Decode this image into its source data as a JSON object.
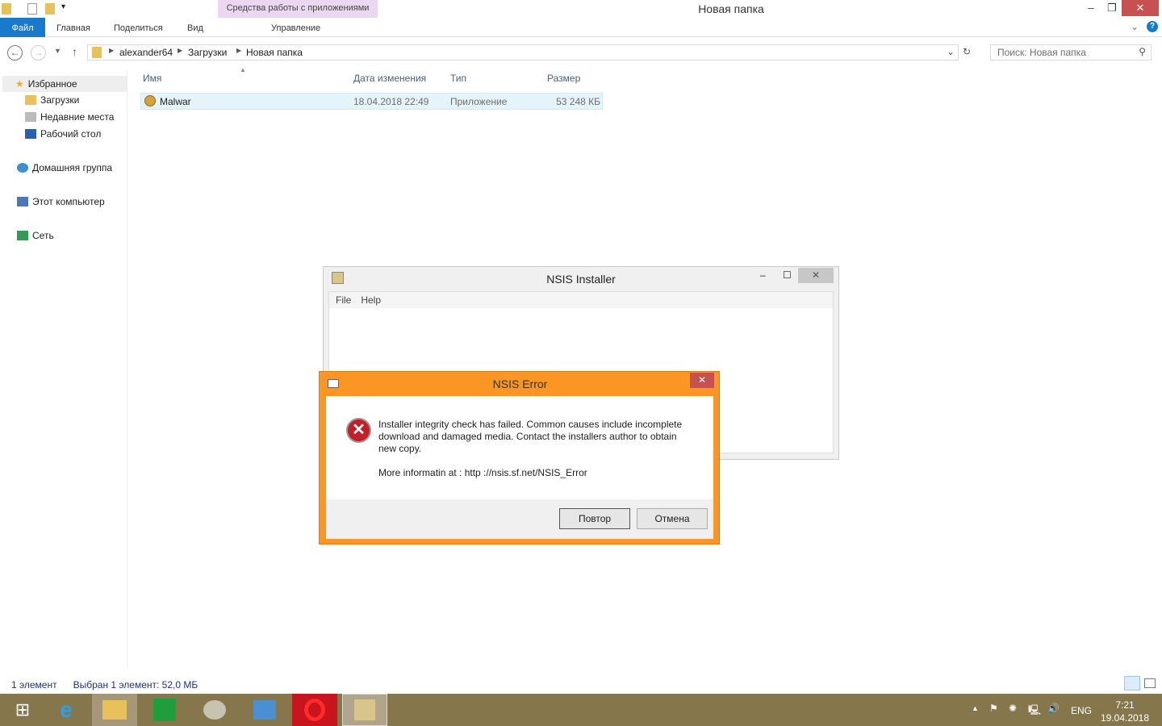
{
  "explorer": {
    "title": "Новая папка",
    "contextual_tab_group": "Средства работы с приложениями",
    "tabs": [
      "Файл",
      "Главная",
      "Поделиться",
      "Вид",
      "Управление"
    ],
    "breadcrumb": [
      "alexander64",
      "Загрузки",
      "Новая папка"
    ],
    "search_placeholder": "Поиск: Новая папка",
    "nav": {
      "favorites": "Избранное",
      "downloads": "Загрузки",
      "recent": "Недавние места",
      "desktop": "Рабочий стол",
      "homegroup": "Домашняя группа",
      "computer": "Этот компьютер",
      "network": "Сеть"
    },
    "columns": [
      "Имя",
      "Дата изменения",
      "Тип",
      "Размер"
    ],
    "files": [
      {
        "name": "Malwar",
        "date": "18.04.2018 22:49",
        "type": "Приложение",
        "size": "53 248 КБ"
      }
    ],
    "status": {
      "count": "1 элемент",
      "selected": "Выбран 1 элемент: 52,0 МБ"
    }
  },
  "installer": {
    "title": "NSIS Installer",
    "menu": [
      "File",
      "Help"
    ]
  },
  "error": {
    "title": "NSIS Error",
    "message": "Installer integrity check has failed. Common causes include incomplete download and damaged media. Contact the installers author to obtain new copy.",
    "more": "More informatin at : http ://nsis.sf.net/NSIS_Error",
    "retry": "Повтор",
    "cancel": "Отмена"
  },
  "tray": {
    "lang": "ENG",
    "time": "7:21",
    "date": "19.04.2018"
  }
}
